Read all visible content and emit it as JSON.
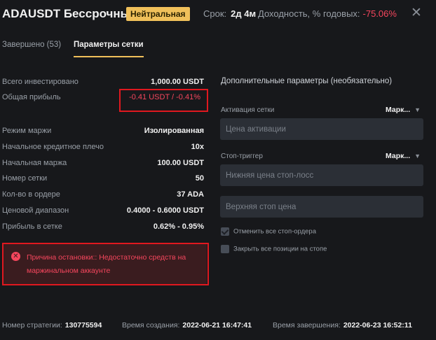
{
  "header": {
    "title": "ADAUSDT Бессрочный",
    "badge": "Нейтральная",
    "term_label": "Срок:",
    "term_value": "2д 4м",
    "yield_label": "Доходность, % годовых:",
    "yield_value": "-75.06%"
  },
  "tabs": [
    {
      "label": "Завершено (53)"
    },
    {
      "label": "Параметры сетки"
    }
  ],
  "params": [
    {
      "label": "Всего инвестировано",
      "value": "1,000.00 USDT"
    },
    {
      "label": "Общая прибыль",
      "value": "-0.41 USDT / -0.41%"
    },
    {
      "label": "Режим маржи",
      "value": "Изолированная"
    },
    {
      "label": "Начальное кредитное плечо",
      "value": "10x"
    },
    {
      "label": "Начальная маржа",
      "value": "100.00 USDT"
    },
    {
      "label": "Номер сетки",
      "value": "50"
    },
    {
      "label": "Кол-во в ордере",
      "value": "37 ADA"
    },
    {
      "label": "Ценовой диапазон",
      "value": "0.4000 - 0.6000 USDT"
    },
    {
      "label": "Прибыль в сетке",
      "value": "0.62% - 0.95%"
    }
  ],
  "extra": {
    "title": "Дополнительные параметры (необязательно)",
    "activation_label": "Активация сетки",
    "activation_type": "Марк...",
    "activation_placeholder": "Цена активации",
    "stop_label": "Стоп-триггер",
    "stop_type": "Марк...",
    "stop_lower_placeholder": "Нижняя цена стоп-лосс",
    "stop_upper_placeholder": "Верхняя стоп цена",
    "cancel_orders_label": "Отменить все стоп-ордера",
    "cancel_orders_checked": true,
    "close_positions_label": "Закрыть все позиции на стопе",
    "close_positions_checked": false
  },
  "stop_reason": {
    "text": "Причина остановки:: Недостаточно средств на маржинальном аккаунте"
  },
  "footer": {
    "strategy_label": "Номер стратегии:",
    "strategy_value": "130775594",
    "created_label": "Время создания:",
    "created_value": "2022-06-21 16:47:41",
    "finished_label": "Время завершения:",
    "finished_value": "2022-06-23 16:52:11"
  },
  "colors": {
    "accent": "#f0c05a",
    "negative": "#f6465d",
    "highlight_frame": "#e0181f"
  }
}
